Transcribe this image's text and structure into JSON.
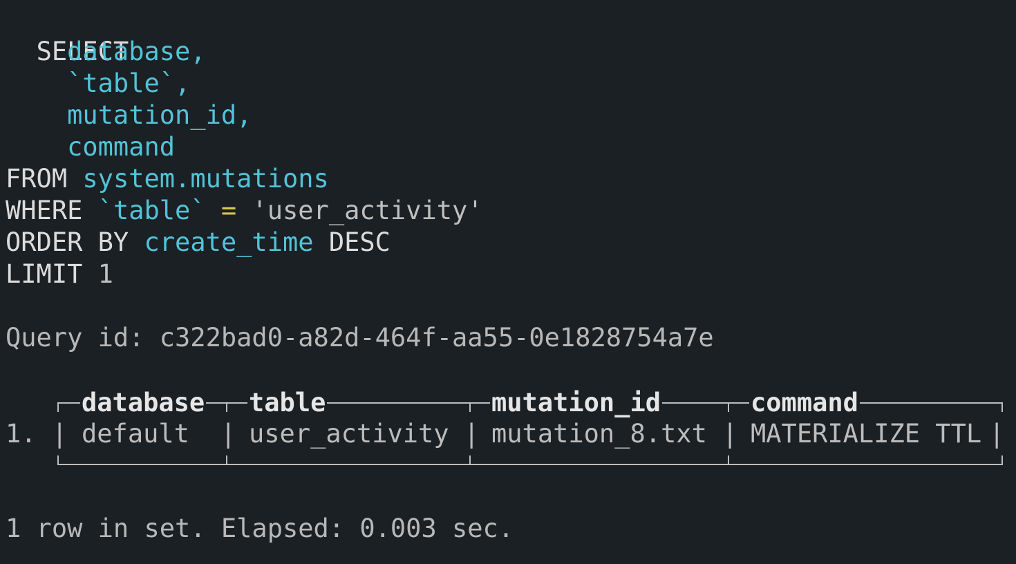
{
  "query": {
    "select_kw": "SELECT",
    "col1": "database,",
    "col2": "`table`,",
    "col3": "mutation_id,",
    "col4": "command",
    "from_kw": "FROM",
    "from_table": "system.mutations",
    "where_kw": "WHERE",
    "where_col": "`table`",
    "where_op": "=",
    "where_val": "'user_activity'",
    "order_kw": "ORDER BY",
    "order_col": "create_time",
    "order_dir": "DESC",
    "limit_kw": "LIMIT",
    "limit_val": "1"
  },
  "query_id_line": "Query id: c322bad0-a82d-464f-aa55-0e1828754a7e",
  "result": {
    "columns": [
      "database",
      "table",
      "mutation_id",
      "command"
    ],
    "rows": [
      {
        "index": "1.",
        "values": [
          "default",
          "user_activity",
          "mutation_8.txt",
          "MATERIALIZE TTL"
        ]
      }
    ]
  },
  "footer": "1 row in set. Elapsed: 0.003 sec.",
  "colors": {
    "background": "#1b2024",
    "identifier": "#52c3d8",
    "operator": "#d6c84a",
    "text": "#d4d4d4"
  }
}
